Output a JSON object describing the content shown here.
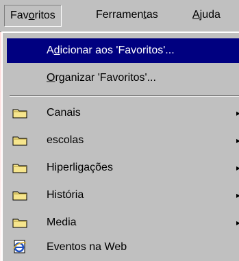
{
  "menubar": {
    "items": [
      {
        "pre": "Fav",
        "u": "o",
        "post": "ritos"
      },
      {
        "pre": "Ferramen",
        "u": "t",
        "post": "as"
      },
      {
        "pre": "",
        "u": "A",
        "post": "juda"
      }
    ]
  },
  "dropdown": {
    "add": {
      "pre": "A",
      "u": "d",
      "post": "icionar aos 'Favoritos'..."
    },
    "organize": {
      "pre": "",
      "u": "O",
      "post": "rganizar 'Favoritos'..."
    },
    "folders": [
      {
        "label": "Canais",
        "icon": "folder-icon",
        "has_submenu": true
      },
      {
        "label": "escolas",
        "icon": "folder-icon",
        "has_submenu": true
      },
      {
        "label": "Hiperligações",
        "icon": "folder-icon",
        "has_submenu": true
      },
      {
        "label": "História",
        "icon": "folder-icon",
        "has_submenu": true
      },
      {
        "label": "Media",
        "icon": "folder-icon",
        "has_submenu": true
      }
    ],
    "link": {
      "label": "Eventos na Web",
      "icon": "ie-page-icon"
    },
    "submenu_arrow": "▸"
  },
  "colors": {
    "highlight": "#000080",
    "menu_bg": "#c0c0c0",
    "folder": "#f6e58d"
  }
}
